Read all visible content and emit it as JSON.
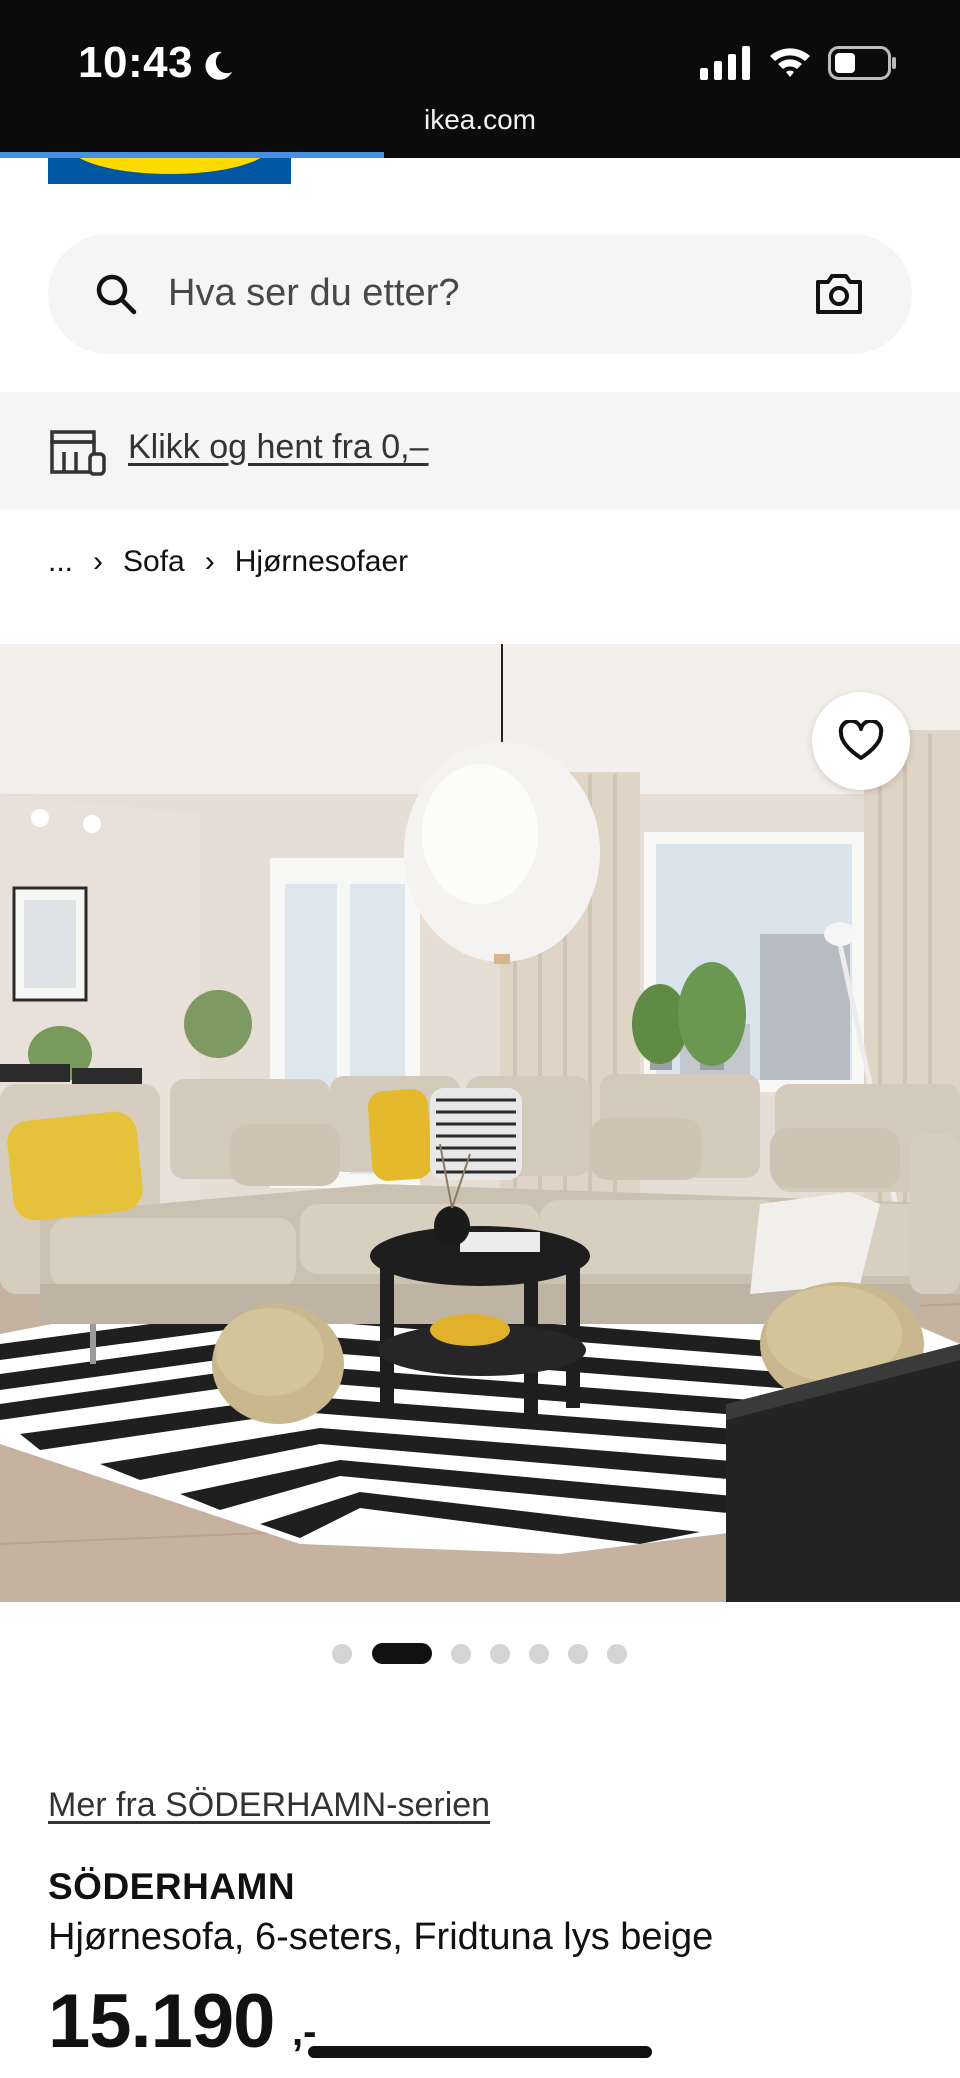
{
  "status_bar": {
    "time": "10:43",
    "url": "ikea.com"
  },
  "search": {
    "placeholder": "Hva ser du etter?"
  },
  "banner": {
    "link_text": "Klikk og hent fra 0,–"
  },
  "breadcrumb": {
    "items": [
      "...",
      "Sofa",
      "Hjørnesofaer"
    ]
  },
  "carousel": {
    "total_images": 7,
    "active_index": 1
  },
  "product": {
    "series_link": "Mer fra SÖDERHAMN-serien",
    "name": "SÖDERHAMN",
    "description": "Hjørnesofa, 6-seters, Fridtuna lys beige",
    "price": "15.190",
    "price_suffix": ",-"
  },
  "colors": {
    "ikea_blue": "#0058a3",
    "ikea_yellow": "#ffdb00",
    "search_bg": "#f5f5f5",
    "progress": "#4a90e2"
  }
}
